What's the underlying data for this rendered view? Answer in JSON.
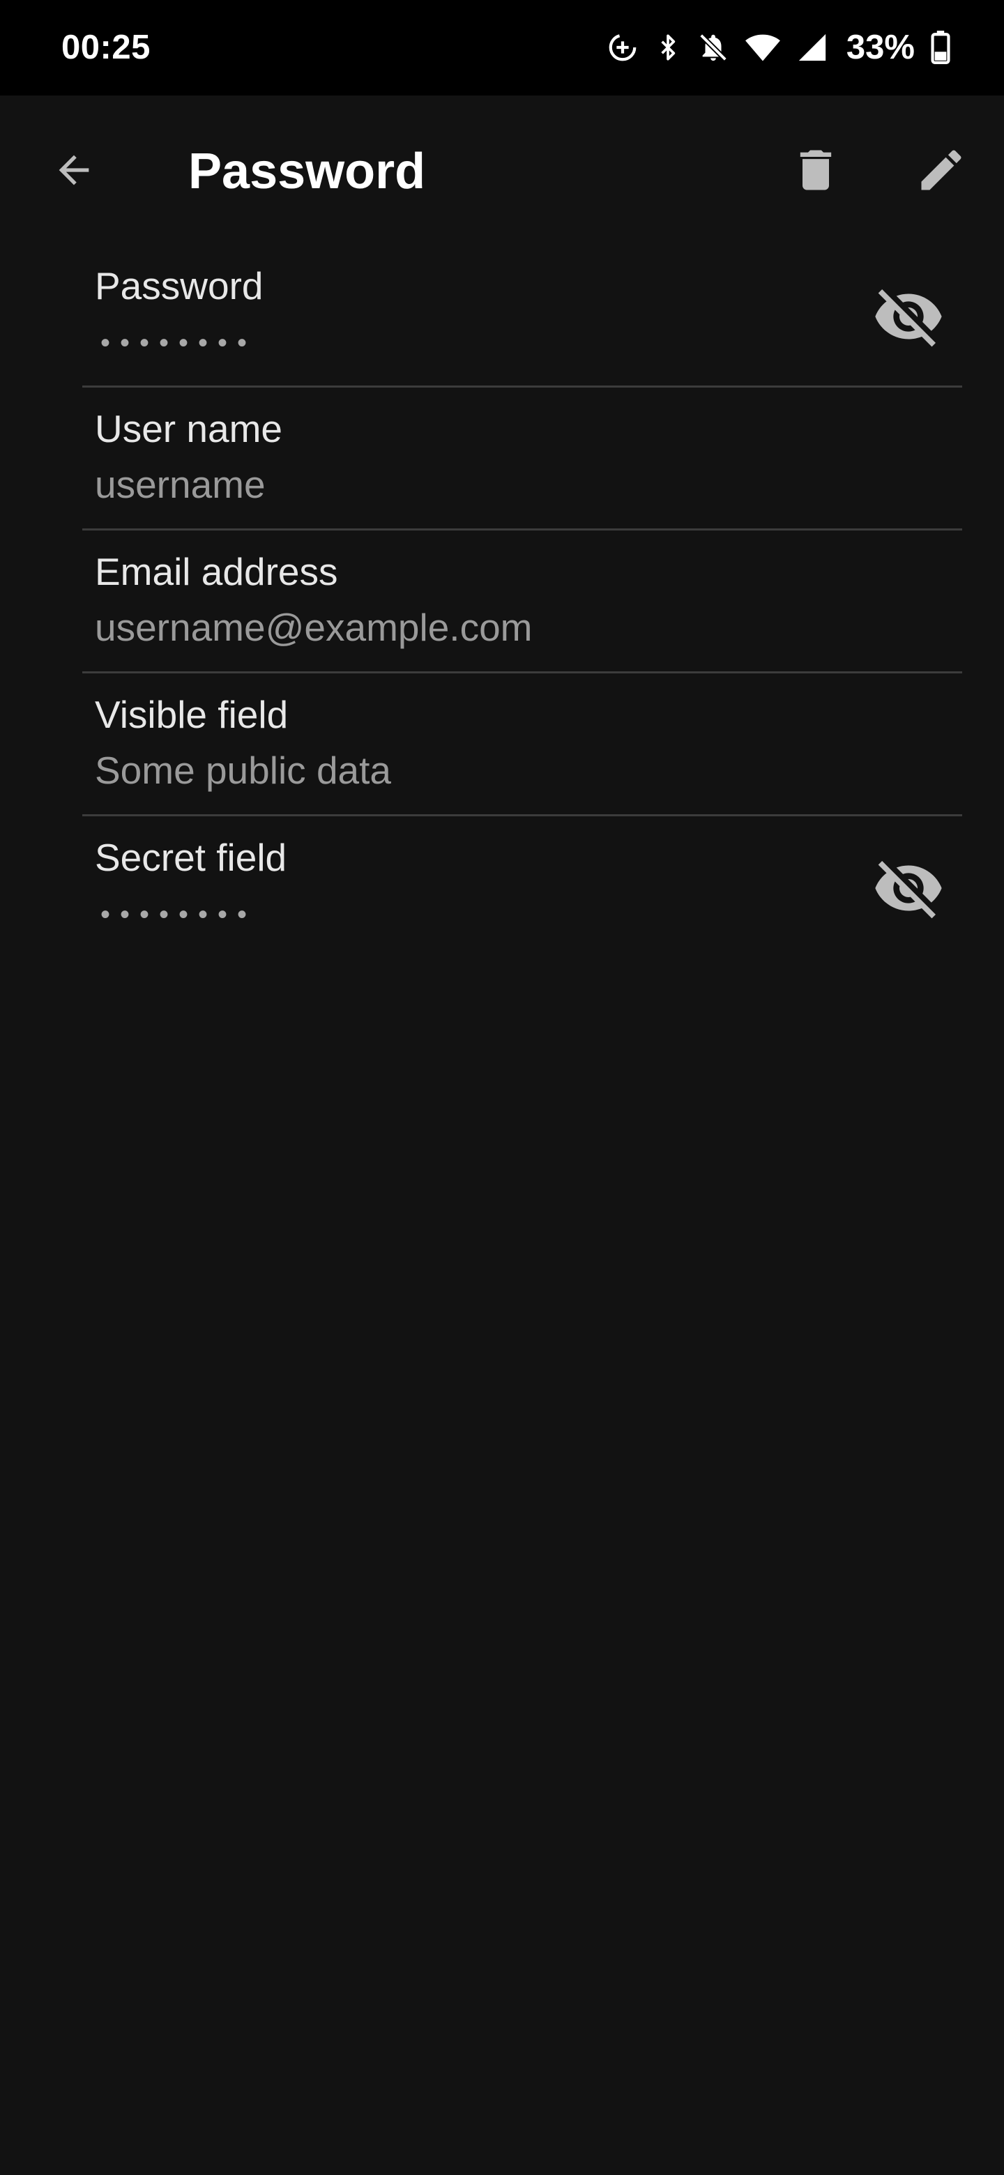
{
  "status_bar": {
    "time": "00:25",
    "battery": "33%",
    "icons": [
      "data-saver-icon",
      "bluetooth-icon",
      "notifications-off-icon",
      "wifi-icon",
      "cellular-signal-icon",
      "battery-icon"
    ]
  },
  "app_bar": {
    "title": "Password",
    "back_icon": "arrow-back-icon",
    "delete_icon": "delete-icon",
    "edit_icon": "edit-icon"
  },
  "fields": [
    {
      "label": "Password",
      "value": "••••••••",
      "masked": true,
      "toggle_icon": "visibility-off-icon"
    },
    {
      "label": "User name",
      "value": "username",
      "masked": false
    },
    {
      "label": "Email address",
      "value": "username@example.com",
      "masked": false
    },
    {
      "label": "Visible field",
      "value": "Some public data",
      "masked": false
    },
    {
      "label": "Secret field",
      "value": "••••••••",
      "masked": true,
      "toggle_icon": "visibility-off-icon"
    }
  ],
  "colors": {
    "background": "#121212",
    "status_bar": "#000000",
    "label_text": "#e8e8e8",
    "value_text": "#9a9a9a",
    "icon": "#bdbdbd",
    "divider": "#3c3c3c"
  }
}
